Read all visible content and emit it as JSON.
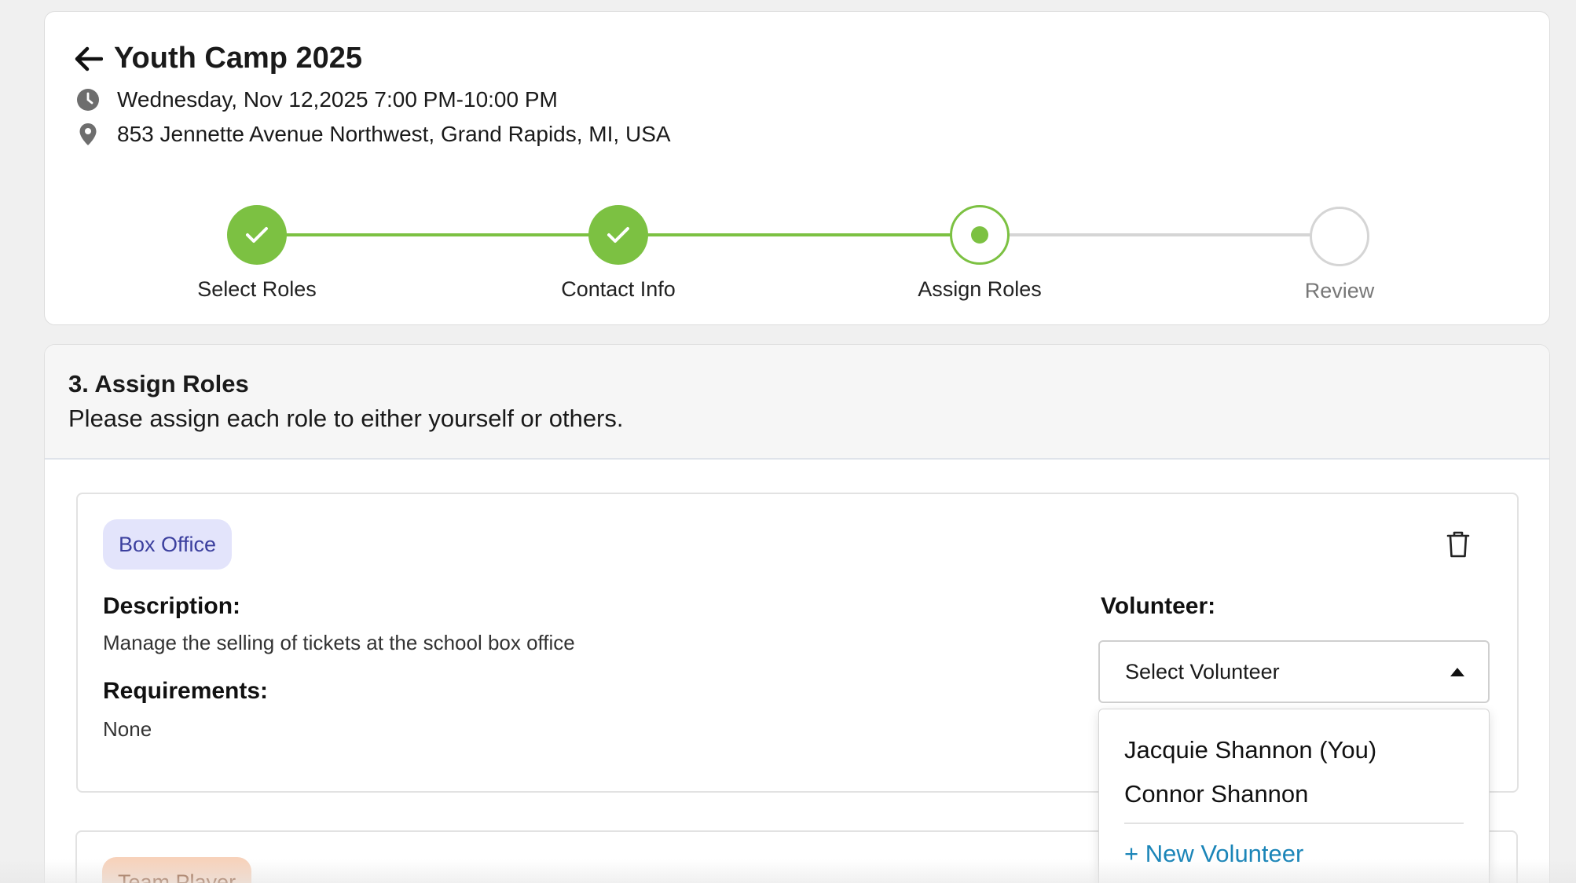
{
  "event": {
    "title": "Youth Camp 2025",
    "datetime": "Wednesday, Nov 12,2025 7:00 PM-10:00 PM",
    "address": "853 Jennette Avenue Northwest, Grand Rapids, MI, USA"
  },
  "stepper": {
    "steps": [
      {
        "label": "Select Roles",
        "state": "complete"
      },
      {
        "label": "Contact Info",
        "state": "complete"
      },
      {
        "label": "Assign Roles",
        "state": "current"
      },
      {
        "label": "Review",
        "state": "upcoming"
      }
    ],
    "colors": {
      "complete": "#7cc142",
      "upcoming": "#d5d5d5"
    }
  },
  "section": {
    "title": "3. Assign Roles",
    "subtitle": "Please assign each role to either yourself or others."
  },
  "role_card": {
    "badge": "Box Office",
    "badge_bg": "#e3e4fb",
    "badge_fg": "#3b3f9e",
    "description_label": "Description:",
    "description": "Manage the selling of tickets at the school box office",
    "requirements_label": "Requirements:",
    "requirements": "None",
    "volunteer_label": "Volunteer:",
    "select_placeholder": "Select Volunteer",
    "dropdown_open": true,
    "options": [
      "Jacquie Shannon (You)",
      "Connor Shannon"
    ],
    "new_volunteer": "+ New Volunteer"
  },
  "role_card_2": {
    "badge": "Team Player",
    "badge_bg": "#f7d2bb",
    "badge_fg": "#8a4a25"
  },
  "icons": {
    "back": "arrow-left-icon",
    "time": "clock-icon",
    "location": "map-pin-icon",
    "delete": "trash-icon",
    "check": "check-icon"
  }
}
